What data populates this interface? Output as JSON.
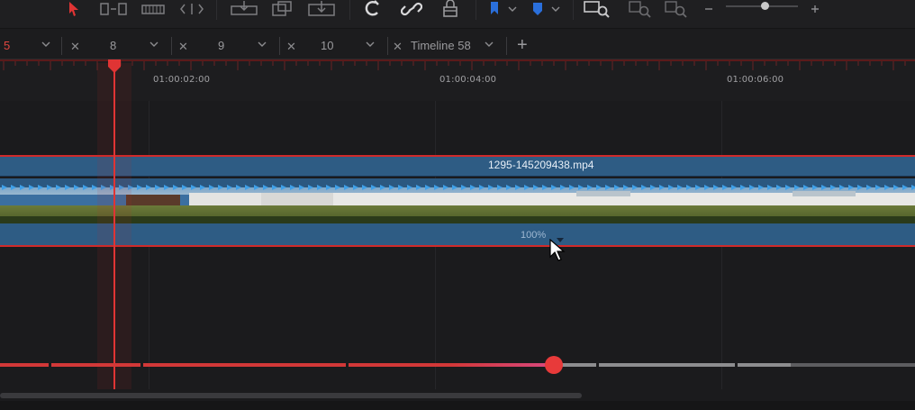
{
  "tabs": [
    {
      "label": "5",
      "active": true
    },
    {
      "label": "8"
    },
    {
      "label": "9"
    },
    {
      "label": "10"
    },
    {
      "label": "Timeline 58"
    }
  ],
  "add_tab_label": "+",
  "ruler": {
    "timecodes": [
      "01:00:02:00",
      "01:00:04:00",
      "01:00:06:00"
    ]
  },
  "clip": {
    "name": "1295-145209438.mp4",
    "speed": "100%"
  },
  "toolbar": {
    "icons": [
      "selection-arrow-icon",
      "trim-edit-icon",
      "blade-edit-icon",
      "dynamic-trim-icon",
      "insert-clip-icon",
      "overwrite-clip-icon",
      "replace-clip-icon",
      "snapping-icon",
      "linked-selection-icon",
      "position-lock-icon",
      "flag-icon",
      "marker-icon",
      "zoom-full-icon",
      "zoom-detail-icon",
      "zoom-custom-icon",
      "zoom-out-icon",
      "zoom-in-icon"
    ]
  },
  "colors": {
    "accent_red": "#e03434",
    "clip_blue": "#2e5c84",
    "flag_blue": "#2a6fdb"
  },
  "playback_progress": 0.6
}
